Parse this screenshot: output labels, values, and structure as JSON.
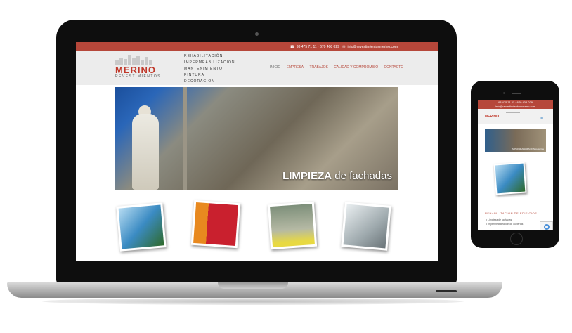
{
  "site": {
    "topbar": {
      "phone": "93 475 71 11  ·  670 408 029",
      "email": "info@revestimientosmerino.com"
    },
    "logo": {
      "brand": "MERINO",
      "tagline": "REVESTIMIENTOS"
    },
    "services": [
      "REHABILITACIÓN",
      "IMPERMEABILIZACIÓN",
      "MANTENIMIENTO",
      "PINTURA",
      "DECORACIÓN"
    ],
    "nav": [
      "INICIO",
      "EMPRESA",
      "TRABAJOS",
      "CALIDAD Y COMPROMISO",
      "CONTACTO"
    ],
    "hero": {
      "bold": "LIMPIEZA",
      "rest": " de fachadas"
    }
  },
  "mobile": {
    "topbar_phone": "93 475 71 11  ·  670 408 029",
    "topbar_email": "info@revestimientosmerino.com",
    "logo": "MERINO",
    "menu_icon": "≡",
    "hero_caption": "IMPERMEABILIZACIÓN cubiertas",
    "section_title": "REHABILITACIÓN DE EDIFICIOS",
    "list": [
      "Limpieza de fachadas",
      "Impermeabilización de cubiertas"
    ]
  },
  "icons": {
    "phone": "phone-icon",
    "mail": "mail-icon",
    "menu": "hamburger-menu-icon"
  },
  "colors": {
    "brand": "#b6473a",
    "logo": "#c0392b",
    "accent_blue": "#2a7bbf"
  }
}
